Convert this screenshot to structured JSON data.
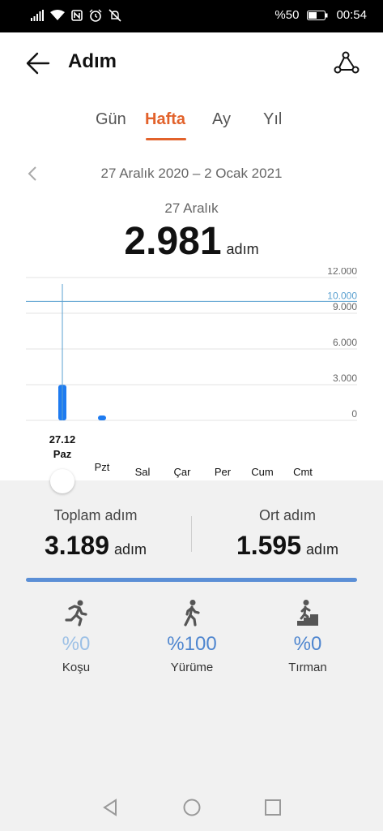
{
  "status_bar": {
    "battery_text": "%50",
    "time": "00:54",
    "icons": [
      "signal-icon",
      "wifi-icon",
      "nfc-icon",
      "alarm-icon",
      "mute-icon",
      "battery-icon"
    ]
  },
  "header": {
    "title": "Adım"
  },
  "tabs": [
    {
      "label": "Gün",
      "active": false
    },
    {
      "label": "Hafta",
      "active": true
    },
    {
      "label": "Ay",
      "active": false
    },
    {
      "label": "Yıl",
      "active": false
    }
  ],
  "range": {
    "label": "27 Aralık 2020 – 2 Ocak 2021"
  },
  "selection": {
    "date": "27 Aralık",
    "value": "2.981",
    "unit": "adım"
  },
  "chart_data": {
    "type": "bar",
    "categories": [
      "Paz",
      "Pzt",
      "Sal",
      "Çar",
      "Per",
      "Cum",
      "Cmt"
    ],
    "values": [
      2981,
      208,
      0,
      0,
      0,
      0,
      0
    ],
    "y_ticks": [
      "12.000",
      "9.000",
      "6.000",
      "3.000",
      "0"
    ],
    "ylim": [
      0,
      12000
    ],
    "goal_line": {
      "value": 10000,
      "label": "10.000"
    },
    "selected_label": "27.12",
    "selected_index": 0,
    "bar_color": "#1e7bf0",
    "goal_color": "#5aa0d0"
  },
  "summary": {
    "total": {
      "label": "Toplam adım",
      "value": "3.189",
      "unit": "adım"
    },
    "average": {
      "label": "Ort adım",
      "value": "1.595",
      "unit": "adım"
    }
  },
  "activities": [
    {
      "icon": "running-icon",
      "percent": "%0",
      "name": "Koşu",
      "color": "#9cc0e6"
    },
    {
      "icon": "walking-icon",
      "percent": "%100",
      "name": "Yürüme",
      "color": "#4f86cf"
    },
    {
      "icon": "climbing-icon",
      "percent": "%0",
      "name": "Tırman",
      "color": "#4f86cf"
    }
  ]
}
